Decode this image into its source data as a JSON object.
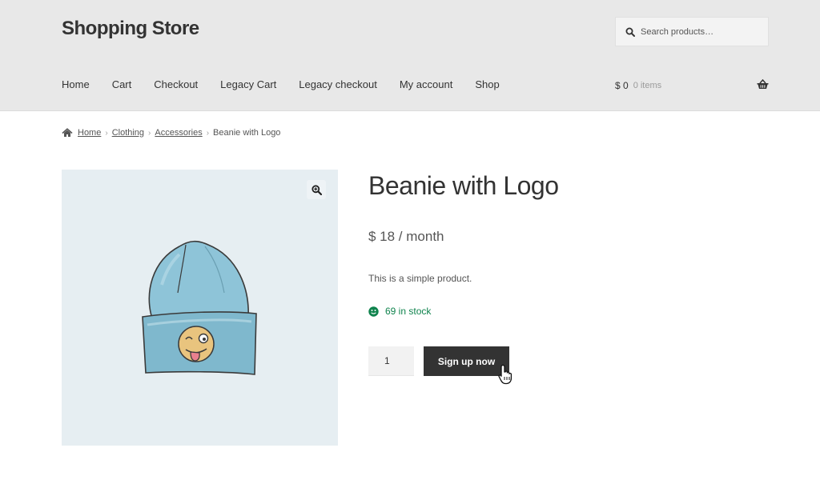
{
  "header": {
    "site_title": "Shopping Store",
    "search": {
      "placeholder": "Search products…"
    },
    "nav": [
      {
        "label": "Home"
      },
      {
        "label": "Cart"
      },
      {
        "label": "Checkout"
      },
      {
        "label": "Legacy Cart"
      },
      {
        "label": "Legacy checkout"
      },
      {
        "label": "My account"
      },
      {
        "label": "Shop"
      }
    ],
    "cart": {
      "amount": "$ 0",
      "count": "0 items",
      "icon": "basket-icon"
    }
  },
  "breadcrumb": {
    "icon": "home-icon",
    "items": [
      {
        "label": "Home"
      },
      {
        "label": "Clothing"
      },
      {
        "label": "Accessories"
      },
      {
        "label": "Beanie with Logo"
      }
    ],
    "separator": "›"
  },
  "product": {
    "title": "Beanie with Logo",
    "price": "$ 18 / month",
    "description": "This is a simple product.",
    "stock": "69 in stock",
    "quantity": "1",
    "button_label": "Sign up now",
    "image_icon": "beanie-image",
    "zoom_icon": "zoom-icon"
  },
  "colors": {
    "header_bg": "#e8e8e8",
    "button_bg": "#333333",
    "stock_green": "#0f834d",
    "gallery_bg": "#e6eef2"
  }
}
